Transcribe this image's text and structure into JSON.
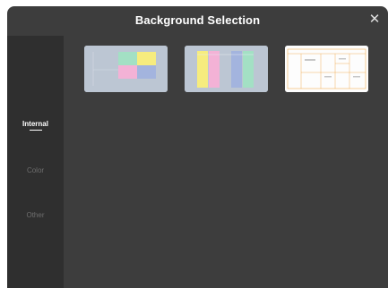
{
  "dialog": {
    "title": "Background Selection",
    "close_icon": "close-icon"
  },
  "sidebar": {
    "items": [
      {
        "label": "Internal",
        "active": true
      },
      {
        "label": "Color",
        "active": false
      },
      {
        "label": "Other",
        "active": false
      }
    ]
  },
  "backgrounds": [
    {
      "name": "quadrant-grid-background",
      "colors": [
        "#a3e0c4",
        "#f6ec7e",
        "#f3b2d6",
        "#a3b4de"
      ]
    },
    {
      "name": "vertical-columns-background",
      "colors": [
        "#f6ec7e",
        "#f3b2d6",
        "#a3b4de",
        "#a3e0c4"
      ]
    },
    {
      "name": "orange-outline-layout-background",
      "colors": [
        "#f0a035"
      ]
    }
  ]
}
